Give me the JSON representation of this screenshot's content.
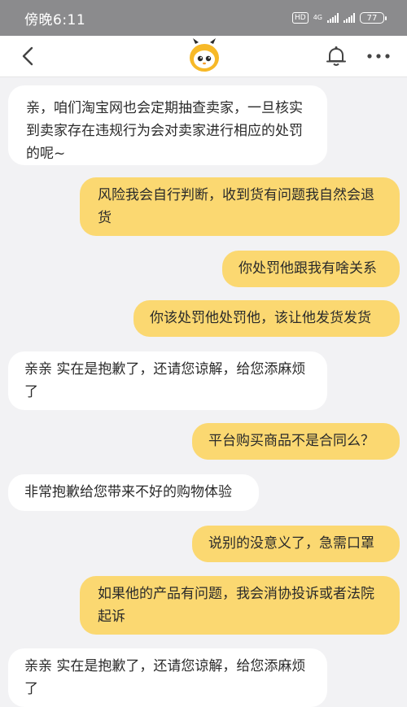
{
  "status_bar": {
    "time": "傍晚6:11",
    "hd": "HD",
    "network": "4G",
    "battery": "77"
  },
  "nav": {
    "back_icon": "chevron-left-icon",
    "logo_icon": "taobao-mascot-icon",
    "bell_icon": "bell-icon",
    "more_icon": "more-dots-icon"
  },
  "colors": {
    "bubble_outgoing": "#fbd871",
    "bubble_incoming": "#ffffff",
    "background": "#f2f2f4",
    "status_bar": "#8b8b8d"
  },
  "messages": [
    {
      "side": "left",
      "text": "亲，咱们淘宝网也会定期抽查卖家，一旦核实到卖家存在违规行为会对卖家进行相应的处罚的呢~"
    },
    {
      "side": "right",
      "text": "风险我会自行判断，收到货有问题我自然会退货"
    },
    {
      "side": "right",
      "text": "你处罚他跟我有啥关系"
    },
    {
      "side": "right",
      "text": "你该处罚他处罚他，该让他发货发货"
    },
    {
      "side": "left",
      "text": "亲亲 实在是抱歉了，还请您谅解，给您添麻烦了"
    },
    {
      "side": "right",
      "text": "平台购买商品不是合同么？"
    },
    {
      "side": "left",
      "text": "非常抱歉给您带来不好的购物体验"
    },
    {
      "side": "right",
      "text": "说别的没意义了，急需口罩"
    },
    {
      "side": "right",
      "text": "如果他的产品有问题，我会消协投诉或者法院起诉"
    },
    {
      "side": "left",
      "text": "亲亲 实在是抱歉了，还请您谅解，给您添麻烦了"
    }
  ]
}
